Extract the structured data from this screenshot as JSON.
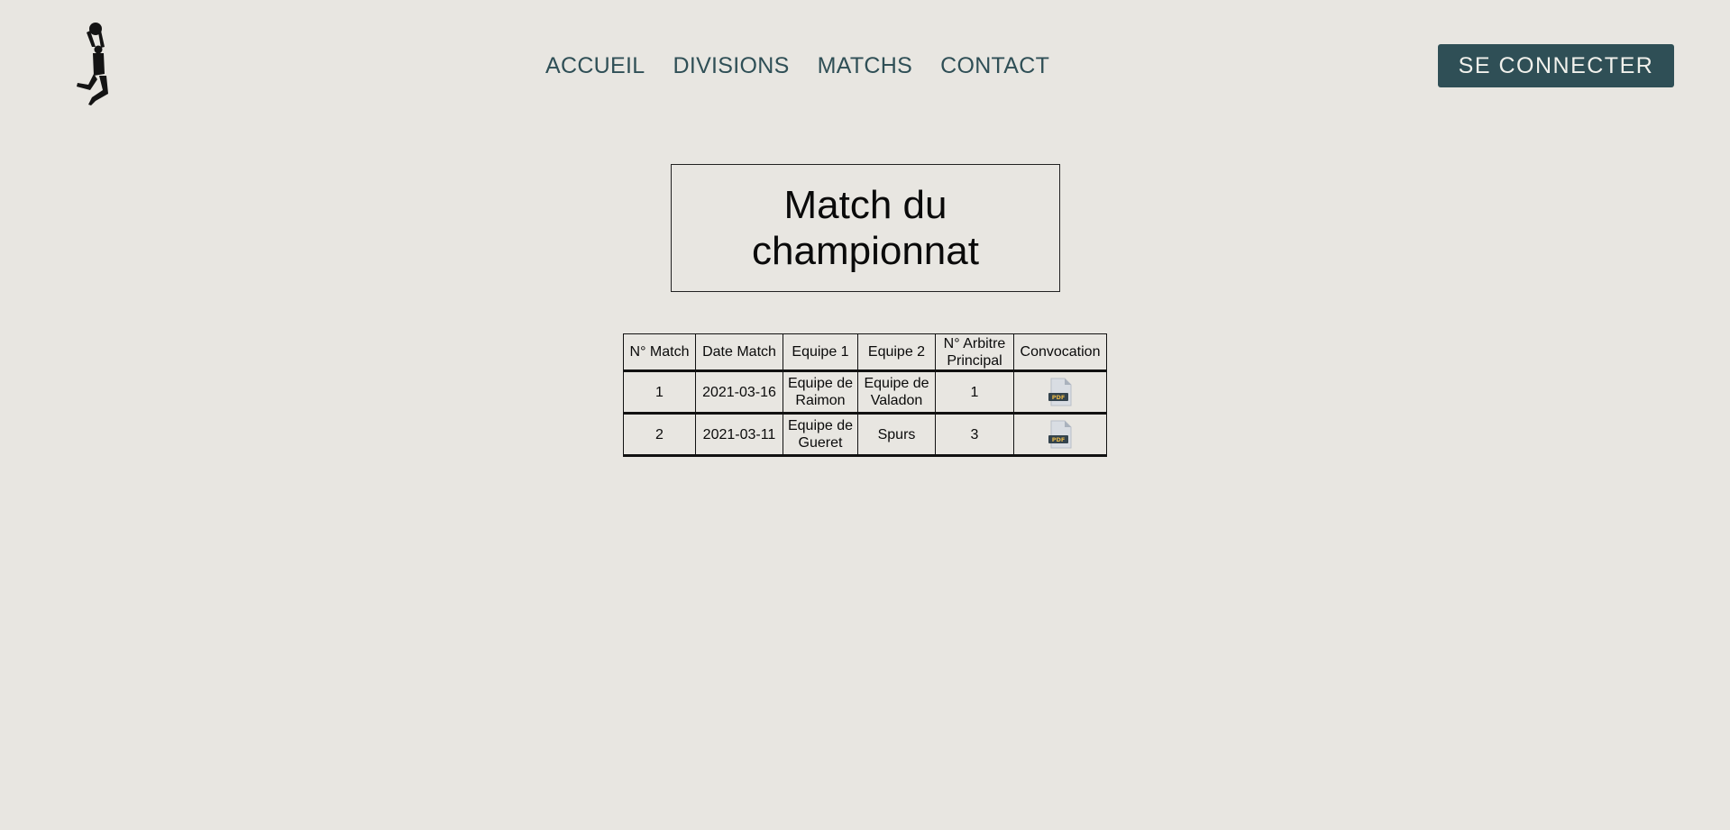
{
  "header": {
    "logo_icon": "basketball-player-dunk-icon",
    "nav": [
      {
        "label": "ACCUEIL"
      },
      {
        "label": "DIVISIONS"
      },
      {
        "label": "MATCHS"
      },
      {
        "label": "CONTACT"
      }
    ],
    "login_label": "SE CONNECTER"
  },
  "main": {
    "title": "Match du championnat",
    "table": {
      "columns": [
        "N° Match",
        "Date Match",
        "Equipe 1",
        "Equipe 2",
        "N° Arbitre Principal",
        "Convocation"
      ],
      "rows": [
        {
          "num": "1",
          "date": "2021-03-16",
          "team1": "Equipe de Raimon",
          "team2": "Equipe de Valadon",
          "referee": "1",
          "convocation_icon": "pdf-file-icon"
        },
        {
          "num": "2",
          "date": "2021-03-11",
          "team1": "Equipe de Gueret",
          "team2": "Spurs",
          "referee": "3",
          "convocation_icon": "pdf-file-icon"
        }
      ]
    }
  },
  "colors": {
    "background": "#e8e6e1",
    "accent": "#2f4f56",
    "button_text": "#f1f1ec"
  }
}
